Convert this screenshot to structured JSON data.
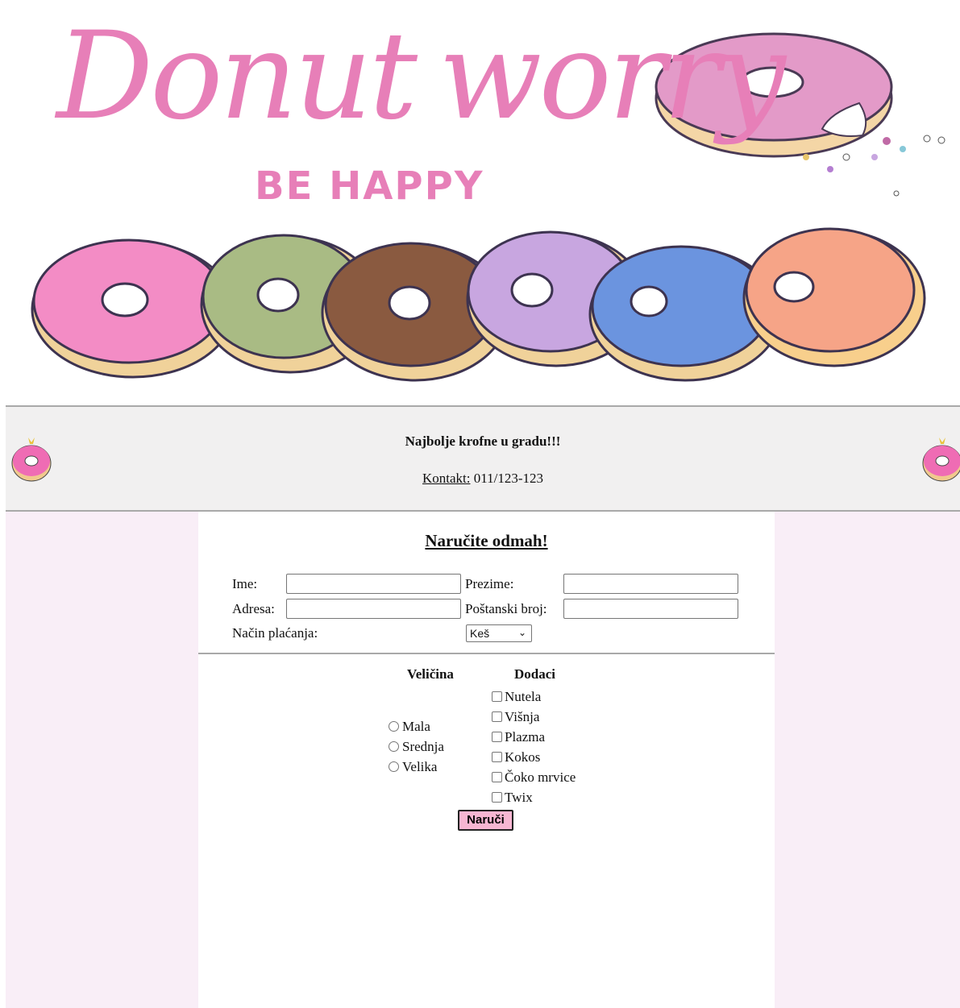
{
  "banner": {
    "title_word_1": "Donut",
    "title_word_2": "worry",
    "subtitle": "BE HAPPY",
    "donut_colors": [
      "#f38cc5",
      "#a9bb84",
      "#8a5a40",
      "#c8a6e0",
      "#6b94df",
      "#f6a487"
    ]
  },
  "header": {
    "tagline": "Najbolje krofne u gradu!!!",
    "contact_label": "Kontakt:",
    "contact_value": "011/123-123",
    "side_icon": "donut-icon"
  },
  "form": {
    "title": "Naručite odmah!",
    "first_name_label": "Ime:",
    "first_name_value": "",
    "last_name_label": "Prezime:",
    "last_name_value": "",
    "address_label": "Adresa:",
    "address_value": "",
    "postal_label": "Poštanski broj:",
    "postal_value": "",
    "payment_label": "Način plaćanja:",
    "payment_selected": "Keš",
    "size_heading": "Veličina",
    "sizes": [
      "Mala",
      "Srednja",
      "Velika"
    ],
    "addons_heading": "Dodaci",
    "addons": [
      "Nutela",
      "Višnja",
      "Plazma",
      "Kokos",
      "Čoko mrvice",
      "Twix"
    ],
    "submit_label": "Naruči"
  },
  "colors": {
    "side_panel": "#f9eef7",
    "header_bg": "#f1f0f0",
    "brand_pink": "#e77fb8",
    "button_pink": "#f7b6d2"
  }
}
